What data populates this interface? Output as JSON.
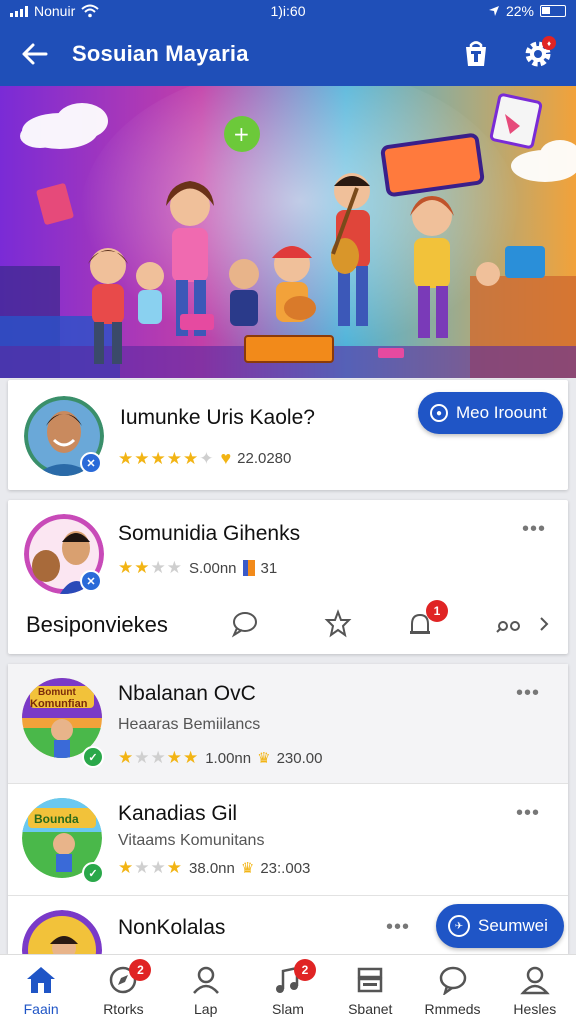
{
  "status_bar": {
    "carrier": "Nonuir",
    "time": "1)i:60",
    "battery": "22%"
  },
  "app_bar": {
    "title": "Sosuian Mayaria"
  },
  "featured": {
    "name": "Iumunke Uris Kaole?",
    "rating": "22.0280",
    "button_label": "Meo Iroount"
  },
  "community_card": {
    "name": "Somunidia Gihenks",
    "rating": "S.00nn",
    "count": "31",
    "actions_label": "Besiponviekes",
    "comment_badge": "1"
  },
  "list": [
    {
      "name": "Nbalanan OvC",
      "subtitle": "Heaaras Bemiilancs",
      "rating": "1.00nn",
      "count": "230.00",
      "thumb_caption": "Komunfian",
      "thumb_title": "Bomunt"
    },
    {
      "name": "Kanadias Gil",
      "subtitle": "Vitaams Komunitans",
      "rating": "38.0nn",
      "count": "23:.003",
      "thumb_caption": "Bounda"
    },
    {
      "name": "NonKolalas",
      "button_label": "Seumwei"
    }
  ],
  "bottom_nav": [
    {
      "label": "Faain",
      "icon": "home-icon",
      "active": true
    },
    {
      "label": "Rtorks",
      "icon": "compass-icon",
      "badge": "2"
    },
    {
      "label": "Lap",
      "icon": "person-icon"
    },
    {
      "label": "Slam",
      "icon": "music-icon",
      "badge": "2"
    },
    {
      "label": "Sbanet",
      "icon": "store-icon"
    },
    {
      "label": "Rmmeds",
      "icon": "chat-icon"
    },
    {
      "label": "Hesles",
      "icon": "profile-icon"
    }
  ],
  "colors": {
    "primary": "#1f55c6",
    "appbar": "#1f4fb8",
    "badge": "#e02424",
    "star": "#f2b414"
  }
}
